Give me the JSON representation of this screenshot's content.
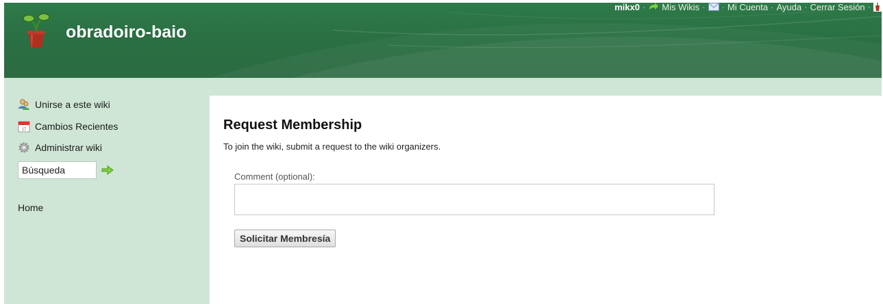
{
  "header": {
    "site_title": "obradoiro-baio",
    "logo_icon": "potted-plant-icon"
  },
  "topnav": {
    "username": "mikx0",
    "my_wikis": "Mis Wikis",
    "my_account": "Mi Cuenta",
    "help": "Ayuda",
    "logout": "Cerrar Sesión",
    "separator": "·"
  },
  "sidebar": {
    "items": [
      {
        "label": "Unirse a este wiki",
        "icon": "join-users-icon"
      },
      {
        "label": "Cambios Recientes",
        "icon": "calendar-icon"
      },
      {
        "label": "Administrar wiki",
        "icon": "gear-icon"
      }
    ],
    "search_value": "Búsqueda",
    "home": "Home"
  },
  "main": {
    "title": "Request Membership",
    "description": "To join the wiki, submit a request to the wiki organizers.",
    "comment_label": "Comment (optional):",
    "comment_value": "",
    "submit_label": "Solicitar Membresía"
  },
  "colors": {
    "header_green": "#2c7346",
    "sidebar_green": "#cfe6d6",
    "content_bg": "#ffffff"
  }
}
